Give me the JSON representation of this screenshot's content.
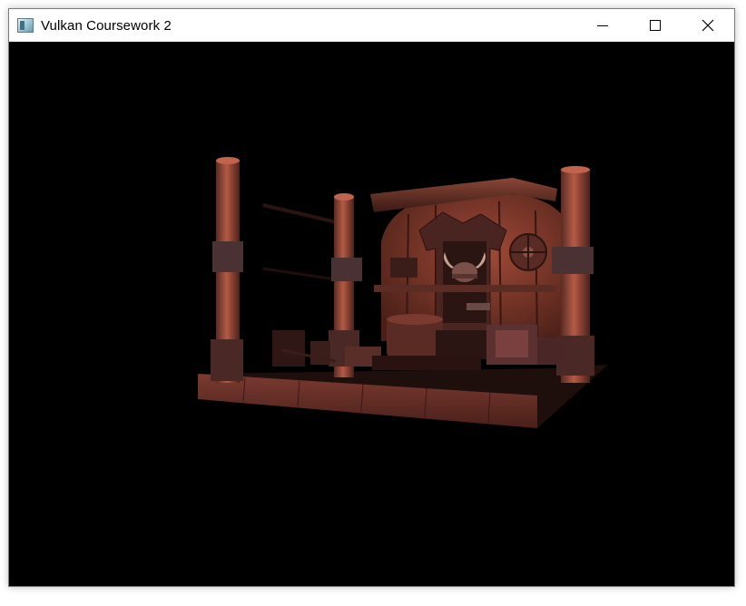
{
  "window": {
    "title": "Vulkan Coursework 2",
    "icon": "app-window-icon",
    "controls": [
      "minimize-icon",
      "maximize-icon",
      "close-icon"
    ]
  },
  "colors": {
    "titlebar_bg": "#ffffff",
    "viewport_bg": "#000000",
    "wood_light": "#a8523e",
    "wood_dark": "#3a1a16"
  }
}
